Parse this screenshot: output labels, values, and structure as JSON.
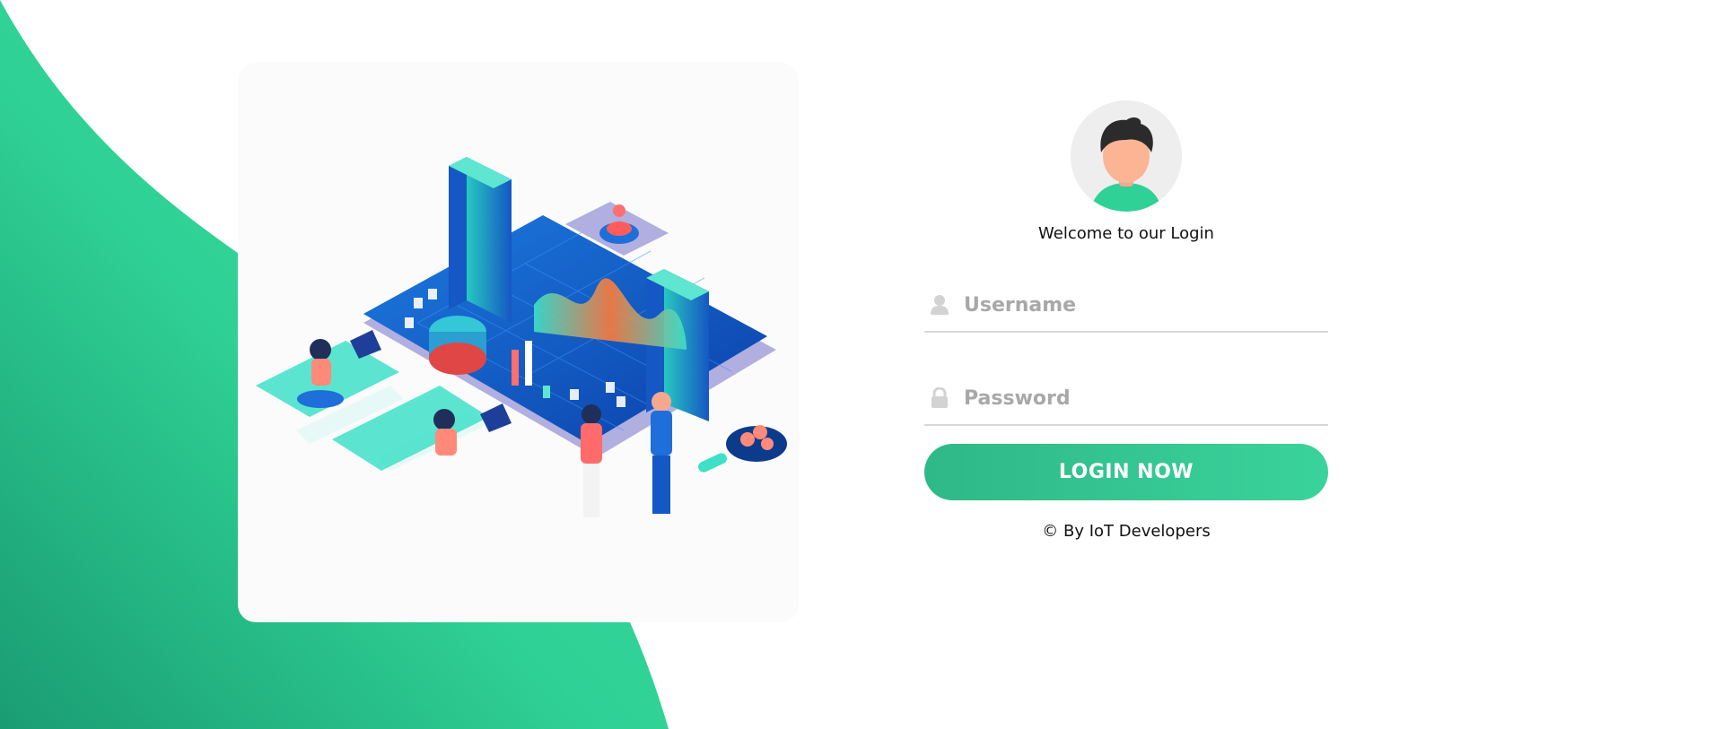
{
  "login": {
    "welcome_text": "Welcome to our Login",
    "username_placeholder": "Username",
    "password_placeholder": "Password",
    "username_value": "",
    "password_value": "",
    "login_button_label": "LOGIN NOW",
    "copyright_text": "© By IoT Developers"
  },
  "icons": {
    "username": "user-icon",
    "password": "lock-icon"
  },
  "colors": {
    "brand_green": "#2fd196",
    "brand_green_dark": "#1a9c72",
    "field_underline": "#d8d8d8",
    "placeholder": "#a8a8a8",
    "card_background": "#fbfbfb"
  }
}
